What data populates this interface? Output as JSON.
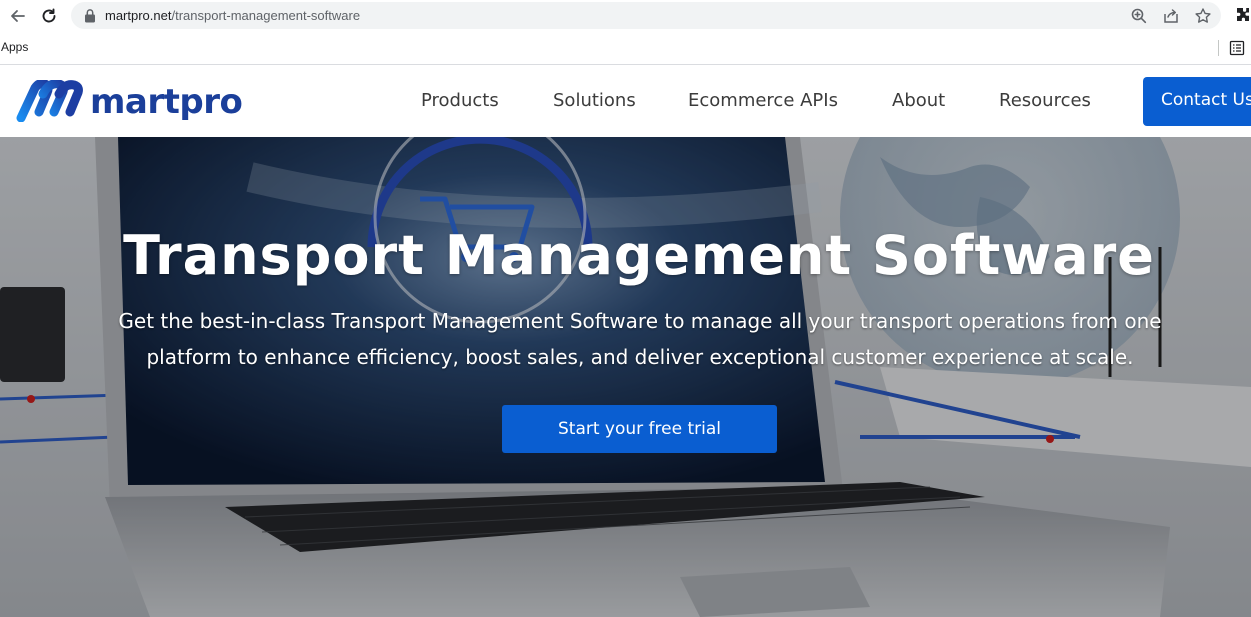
{
  "browser": {
    "url_host": "martpro.net",
    "url_path": "/transport-management-software",
    "bookmarks_apps_label": "Apps",
    "icons": [
      "back-icon",
      "reload-icon",
      "lock-icon",
      "zoom-icon",
      "share-icon",
      "star-icon",
      "extensions-icon",
      "reading-list-icon"
    ]
  },
  "site": {
    "logo_text": "martpro",
    "nav": [
      {
        "label": "Products"
      },
      {
        "label": "Solutions"
      },
      {
        "label": "Ecommerce APIs"
      },
      {
        "label": "About"
      },
      {
        "label": "Resources"
      }
    ],
    "contact_label": "Contact Us"
  },
  "hero": {
    "title": "Transport Management Software",
    "subtitle": "Get the best-in-class Transport Management Software to manage all your transport operations from one platform to enhance efficiency, boost sales, and deliver exceptional customer experience at scale.",
    "cta_label": "Start your free trial"
  },
  "colors": {
    "brand_blue": "#0a5ed1",
    "logo_blue": "#1b3f9a",
    "nav_text": "#3c3c3c"
  }
}
